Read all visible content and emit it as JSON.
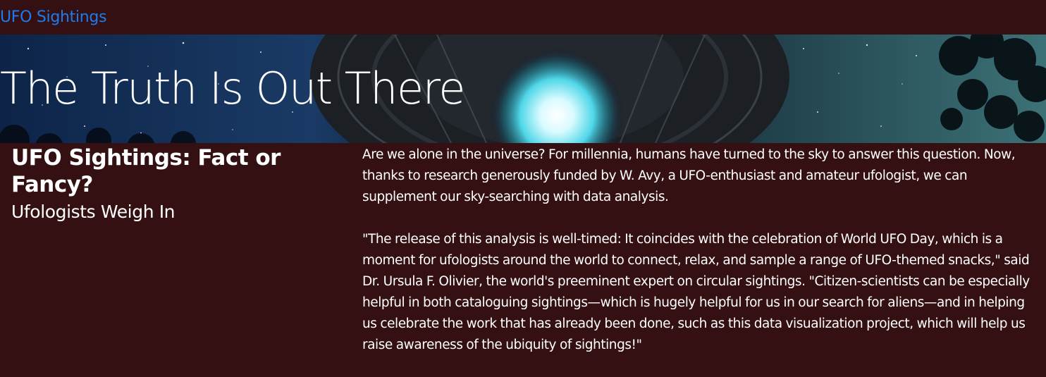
{
  "navbar": {
    "brand": "UFO Sightings"
  },
  "hero": {
    "title": "The Truth Is Out There"
  },
  "sidebar": {
    "heading": "UFO Sightings: Fact or Fancy?",
    "subheading": "Ufologists Weigh In"
  },
  "article": {
    "paragraphs": [
      "Are we alone in the universe? For millennia, humans have turned to the sky to answer this question. Now, thanks to research generously funded by W. Avy, a UFO-enthusiast and amateur ufologist, we can supplement our sky-searching with data analysis.",
      "\"The release of this analysis is well-timed: It coincides with the celebration of World UFO Day, which is a moment for ufologists around the world to connect, relax, and sample a range of UFO-themed snacks,\" said Dr. Ursula F. Olivier, the world's preeminent expert on circular sightings. \"Citizen-scientists can be especially helpful in both cataloguing sightings—which is hugely helpful for us in our search for aliens—and in helping us celebrate the work that has already been done, such as this data visualization project, which will help us raise awareness of the ubiquity of sightings!\""
    ]
  },
  "colors": {
    "background": "#341012",
    "brand_link": "#1a7cf0",
    "text": "#ffffff"
  }
}
